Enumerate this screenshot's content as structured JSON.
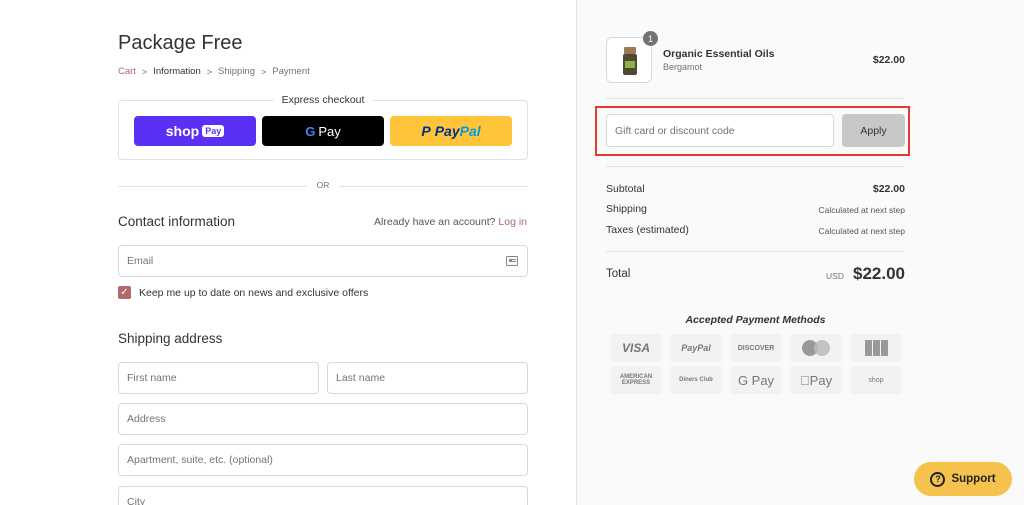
{
  "store": {
    "name": "Package Free"
  },
  "breadcrumb": {
    "cart": "Cart",
    "information": "Information",
    "shipping": "Shipping",
    "payment": "Payment",
    "separator": ">"
  },
  "express_checkout": {
    "title": "Express checkout",
    "shop_pay": {
      "word": "shop",
      "badge": "Pay"
    },
    "google_pay": {
      "g": "G",
      "word": "Pay"
    },
    "paypal": {
      "p": "P",
      "word_a": "Pay",
      "word_b": "Pal"
    }
  },
  "or_label": "OR",
  "contact": {
    "title": "Contact information",
    "account_prompt": "Already have an account?",
    "login_link": "Log in",
    "email_placeholder": "Email",
    "newsletter_label": "Keep me up to date on news and exclusive offers",
    "newsletter_checked": true
  },
  "shipping_address": {
    "title": "Shipping address",
    "first_name_placeholder": "First name",
    "last_name_placeholder": "Last name",
    "address_placeholder": "Address",
    "apartment_placeholder": "Apartment, suite, etc. (optional)",
    "city_placeholder": "City"
  },
  "order": {
    "item": {
      "name": "Organic Essential Oils",
      "variant": "Bergamot",
      "price": "$22.00",
      "quantity": "1"
    },
    "discount_placeholder": "Gift card or discount code",
    "apply_label": "Apply",
    "subtotal_label": "Subtotal",
    "subtotal_value": "$22.00",
    "shipping_label": "Shipping",
    "shipping_value": "Calculated at next step",
    "taxes_label": "Taxes (estimated)",
    "taxes_value": "Calculated at next step",
    "total_label": "Total",
    "total_currency": "USD",
    "total_value": "$22.00"
  },
  "payment_methods": {
    "title": "Accepted Payment Methods",
    "visa": "VISA",
    "paypal": "PayPal",
    "discover": "DISCOVER",
    "amex": "AMERICAN EXPRESS",
    "diners": "Diners Club",
    "google_pay": "G Pay",
    "apple_pay": "Pay",
    "shop_pay": "shop"
  },
  "support": {
    "label": "Support",
    "icon_glyph": "?"
  },
  "colors": {
    "accent": "#b06a6a",
    "shop_pay": "#5a31f4",
    "paypal_yellow": "#ffc439",
    "support_yellow": "#f4c24d",
    "highlight_red": "#e53935"
  }
}
